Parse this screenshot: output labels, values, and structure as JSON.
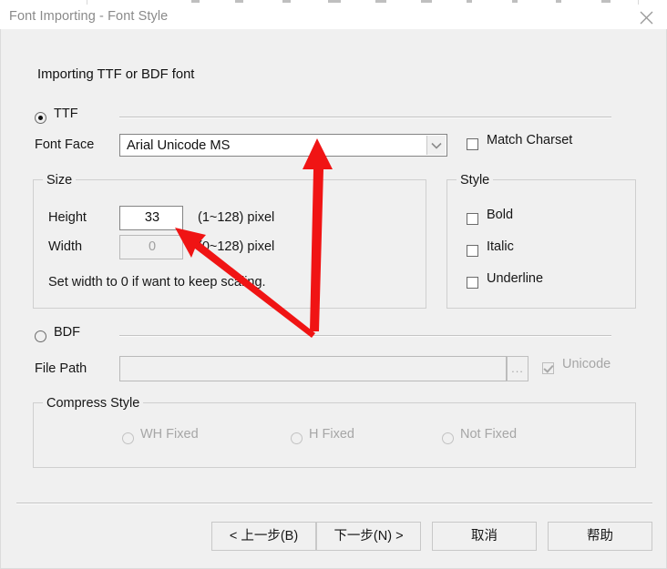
{
  "window": {
    "title": "Font Importing - Font Style",
    "close_icon": "close-icon"
  },
  "heading": "Importing TTF or BDF font",
  "ttf_section": {
    "radio_label": "TTF",
    "radio_selected": true,
    "font_face_label": "Font Face",
    "font_face_value": "Arial Unicode MS",
    "font_face_dropdown_icon": "chevron-down-icon",
    "match_charset_label": "Match Charset",
    "match_charset_checked": false
  },
  "size_group": {
    "title": "Size",
    "height_label": "Height",
    "height_value": "33",
    "height_hint": "(1~128) pixel",
    "width_label": "Width",
    "width_value": "0",
    "width_hint": "(0~128) pixel",
    "note": "Set width to 0 if want to keep scaling."
  },
  "style_group": {
    "title": "Style",
    "items": [
      {
        "label": "Bold",
        "checked": false
      },
      {
        "label": "Italic",
        "checked": false
      },
      {
        "label": "Underline",
        "checked": false
      }
    ]
  },
  "bdf_section": {
    "radio_label": "BDF",
    "radio_selected": false,
    "file_path_label": "File Path",
    "file_path_value": "",
    "browse_label": "...",
    "unicode_label": "Unicode",
    "unicode_checked": true,
    "disabled": true
  },
  "compress_group": {
    "title": "Compress Style",
    "items": [
      {
        "label": "WH Fixed",
        "selected": false
      },
      {
        "label": "H Fixed",
        "selected": false
      },
      {
        "label": "Not Fixed",
        "selected": false
      }
    ],
    "disabled": true
  },
  "buttons": {
    "back": "< 上一步(B)",
    "next": "下一步(N) >",
    "cancel": "取消",
    "help": "帮助"
  },
  "annotations": {
    "arrow_color": "#f01414",
    "arrows": [
      {
        "name": "arrow-to-font-face-combo",
        "target": "font-face-combo"
      },
      {
        "name": "arrow-to-height-field",
        "target": "height-field"
      }
    ]
  }
}
